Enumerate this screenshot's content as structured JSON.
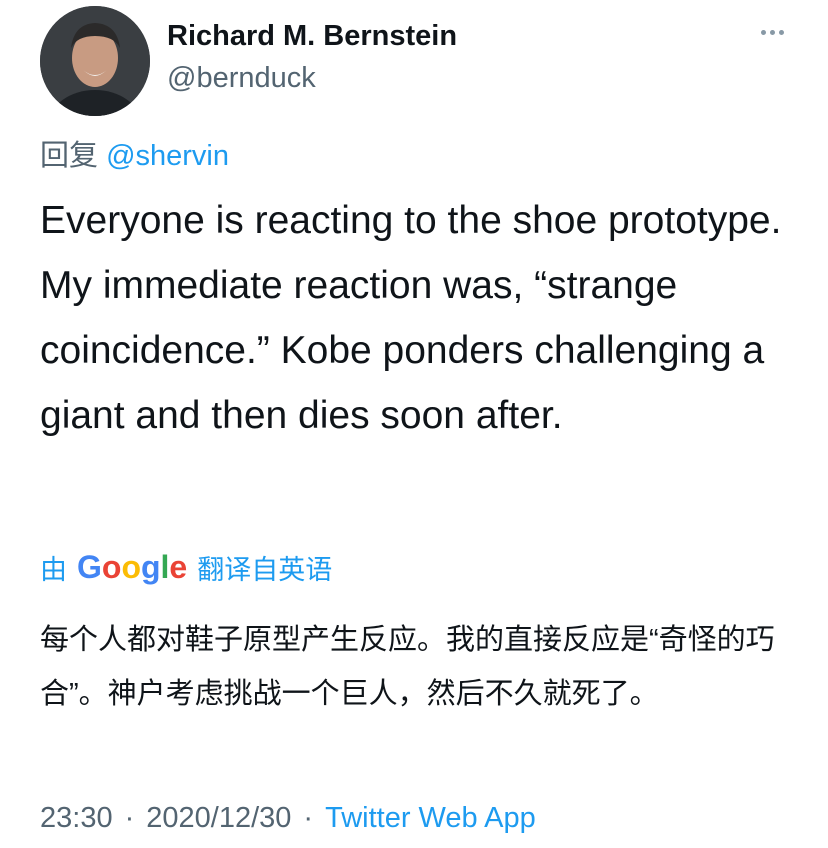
{
  "author": {
    "display_name": "Richard M. Bernstein",
    "handle": "@bernduck"
  },
  "reply": {
    "prefix": "回复",
    "mention": "@shervin"
  },
  "tweet": {
    "text": "Everyone is reacting to the shoe prototype. My immediate reaction was, “strange coincidence.”  Kobe ponders challenging a giant and then dies soon after."
  },
  "translation": {
    "by": "由",
    "provider": "Google",
    "label": "翻译自英语",
    "text": "每个人都对鞋子原型产生反应。我的直接反应是“奇怪的巧合”。神户考虑挑战一个巨人，然后不久就死了。"
  },
  "meta": {
    "time": "23:30",
    "date": "2020/12/30",
    "separator": "·",
    "source": "Twitter Web App"
  },
  "icons": {
    "more": "more-horizontal-icon"
  },
  "colors": {
    "link": "#1d9bf0",
    "secondary": "#536471",
    "text": "#0f1419",
    "google_blue": "#4285f4",
    "google_red": "#ea4335",
    "google_yellow": "#fbbc05",
    "google_green": "#34a853"
  }
}
